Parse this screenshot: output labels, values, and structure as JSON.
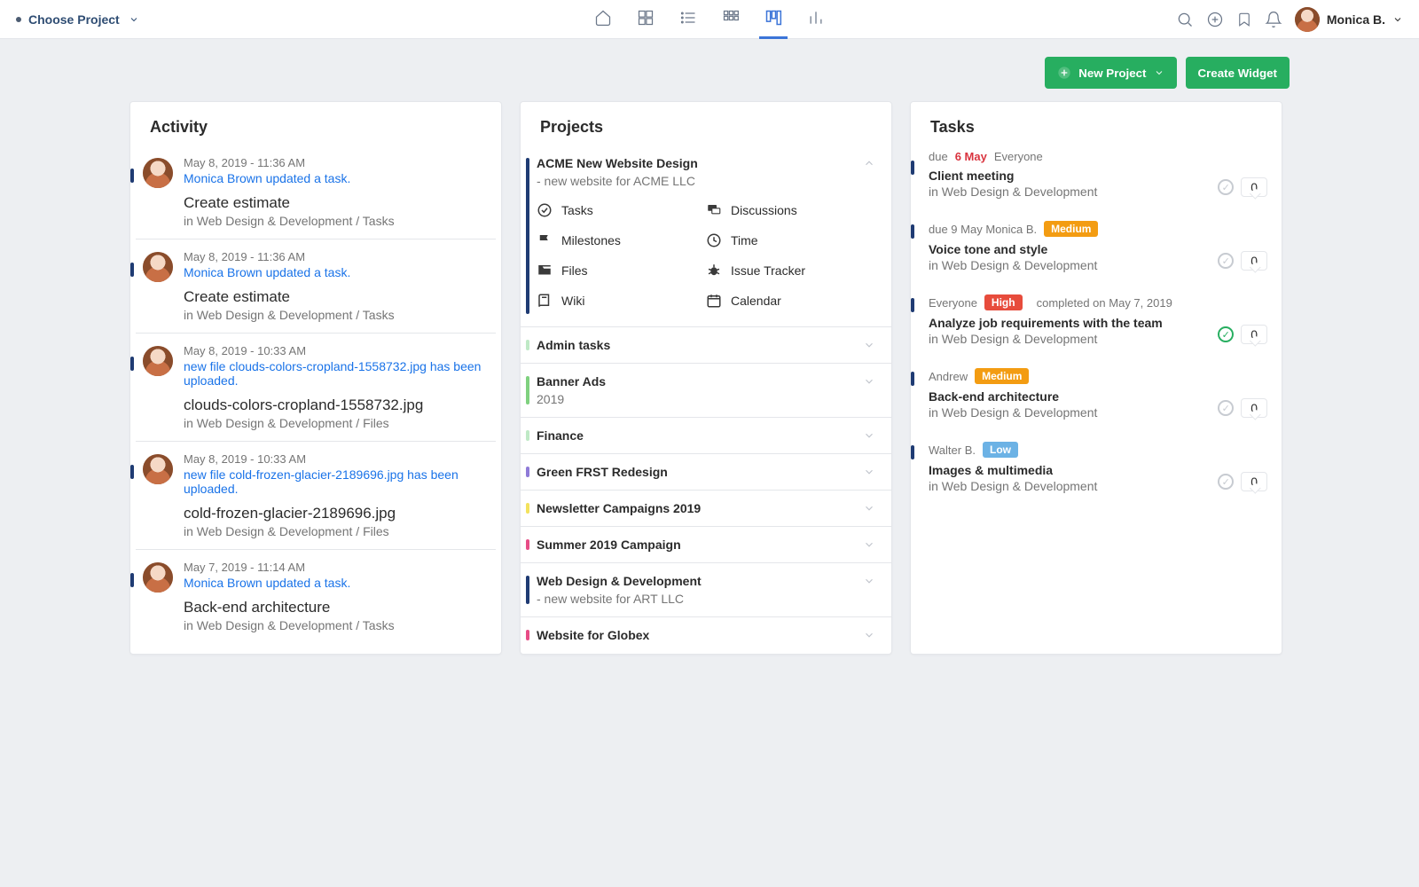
{
  "topbar": {
    "choose_project": "Choose Project",
    "user_name": "Monica B."
  },
  "buttons": {
    "new_project": "New Project",
    "create_widget": "Create Widget"
  },
  "activity": {
    "title": "Activity",
    "items": [
      {
        "time": "May 8, 2019 - 11:36 AM",
        "action": "Monica Brown updated a task.",
        "object": "Create estimate",
        "loc": "in Web Design & Development / Tasks"
      },
      {
        "time": "May 8, 2019 - 11:36 AM",
        "action": "Monica Brown updated a task.",
        "object": "Create estimate",
        "loc": "in Web Design & Development / Tasks"
      },
      {
        "time": "May 8, 2019 - 10:33 AM",
        "action": "new file clouds-colors-cropland-1558732.jpg has been uploaded.",
        "object": "clouds-colors-cropland-1558732.jpg",
        "loc": "in Web Design & Development / Files"
      },
      {
        "time": "May 8, 2019 - 10:33 AM",
        "action": "new file cold-frozen-glacier-2189696.jpg has been uploaded.",
        "object": "cold-frozen-glacier-2189696.jpg",
        "loc": "in Web Design & Development / Files"
      },
      {
        "time": "May 7, 2019 - 11:14 AM",
        "action": "Monica Brown updated a task.",
        "object": "Back-end architecture",
        "loc": "in Web Design & Development / Tasks"
      }
    ]
  },
  "projects": {
    "title": "Projects",
    "featured": {
      "name": "ACME New Website Design",
      "sub": "- new website for ACME LLC",
      "links": {
        "tasks": "Tasks",
        "discussions": "Discussions",
        "milestones": "Milestones",
        "time": "Time",
        "files": "Files",
        "issue_tracker": "Issue Tracker",
        "wiki": "Wiki",
        "calendar": "Calendar"
      }
    },
    "list": [
      {
        "name": "Admin tasks",
        "color": "#bfe9c6"
      },
      {
        "name": "Banner Ads",
        "sub": "2019",
        "color": "#7fd17f"
      },
      {
        "name": "Finance",
        "color": "#bfe9c6"
      },
      {
        "name": "Green FRST Redesign",
        "color": "#8f7bd8"
      },
      {
        "name": "Newsletter Campaigns 2019",
        "color": "#f3e25d"
      },
      {
        "name": "Summer 2019 Campaign",
        "color": "#e74c86"
      },
      {
        "name": "Web Design & Development",
        "sub": "- new website for ART LLC",
        "color": "#1f3b73"
      },
      {
        "name": "Website for Globex",
        "color": "#e74c86"
      }
    ]
  },
  "tasks": {
    "title": "Tasks",
    "items": [
      {
        "meta_pre": "due ",
        "meta_red": "6 May",
        "meta_post": " Everyone",
        "title": "Client meeting",
        "loc": "in Web Design & Development",
        "done": false,
        "count": "0"
      },
      {
        "meta_pre": "due 9 May Monica B.",
        "badge": "Medium",
        "badge_class": "b-medium",
        "title": "Voice tone and style",
        "loc": "in Web Design & Development",
        "done": false,
        "count": "0"
      },
      {
        "meta_pre": "Everyone",
        "badge": "High",
        "badge_class": "b-high",
        "meta_post2": "completed on May 7, 2019",
        "title": "Analyze job requirements with the team",
        "loc": "in Web Design & Development",
        "done": true,
        "count": "0"
      },
      {
        "meta_pre": "Andrew",
        "badge": "Medium",
        "badge_class": "b-medium",
        "title": "Back-end architecture",
        "loc": "in Web Design & Development",
        "done": false,
        "count": "0"
      },
      {
        "meta_pre": "Walter B.",
        "badge": "Low",
        "badge_class": "b-low",
        "title": "Images & multimedia",
        "loc": "in Web Design & Development",
        "done": false,
        "count": "0"
      }
    ]
  }
}
